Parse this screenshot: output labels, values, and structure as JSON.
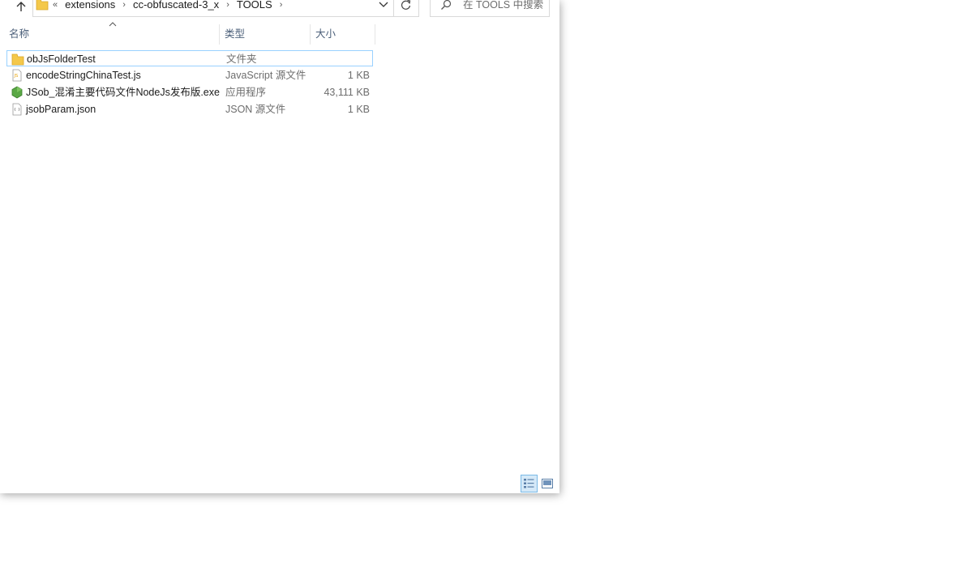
{
  "address_bar": {
    "overflow": "«",
    "crumbs": [
      "extensions",
      "cc-obfuscated-3_x",
      "TOOLS"
    ],
    "separator": "›"
  },
  "search": {
    "placeholder": "在 TOOLS 中搜索"
  },
  "columns": {
    "name": "名称",
    "type": "类型",
    "size": "大小"
  },
  "files": [
    {
      "name": "obJsFolderTest",
      "type": "文件夹",
      "size": "",
      "icon": "folder-icon",
      "selected": true
    },
    {
      "name": "encodeStringChinaTest.js",
      "type": "JavaScript 源文件",
      "size": "1 KB",
      "icon": "js-file-icon",
      "selected": false
    },
    {
      "name": "JSob_混淆主要代码文件NodeJs发布版.exe",
      "type": "应用程序",
      "size": "43,111 KB",
      "icon": "nodejs-exe-icon",
      "selected": false
    },
    {
      "name": "jsobParam.json",
      "type": "JSON 源文件",
      "size": "1 KB",
      "icon": "json-file-icon",
      "selected": false
    }
  ],
  "colors": {
    "accent": "#99d1ff",
    "header_text": "#4c607a",
    "folder": "#f4c84a"
  }
}
